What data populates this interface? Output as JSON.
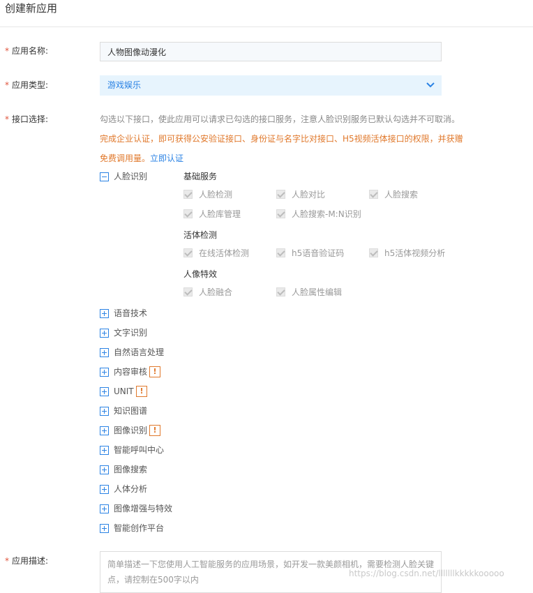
{
  "page_title": "创建新应用",
  "form": {
    "required_mark": "*",
    "app_name": {
      "label": "应用名称:",
      "value": "人物图像动漫化"
    },
    "app_type": {
      "label": "应用类型:",
      "value": "游戏娱乐",
      "icon": "chevron-down-icon"
    },
    "api_select": {
      "label": "接口选择:",
      "hint": "勾选以下接口，使此应用可以请求已勾选的接口服务，注意人脸识别服务已默认勾选并不可取消。",
      "notice": "完成企业认证，即可获得公安验证接口、身份证与名字比对接口、H5视频活体接口的权限，并获赠免费调用量。",
      "notice_link": "立即认证"
    },
    "app_desc": {
      "label": "应用描述:",
      "placeholder": "简单描述一下您使用人工智能服务的应用场景，如开发一款美颜相机，需要检测人脸关键点，请控制在500字以内"
    }
  },
  "face_recognition": {
    "label": "人脸识别",
    "groups": [
      {
        "title": "基础服务",
        "items": [
          "人脸检测",
          "人脸对比",
          "人脸搜索",
          "人脸库管理",
          "人脸搜索-M:N识别"
        ]
      },
      {
        "title": "活体检测",
        "items": [
          "在线活体检测",
          "h5语音验证码",
          "h5活体视频分析"
        ]
      },
      {
        "title": "人像特效",
        "items": [
          "人脸融合",
          "人脸属性编辑"
        ]
      }
    ]
  },
  "categories": [
    {
      "label": "语音技术"
    },
    {
      "label": "文字识别"
    },
    {
      "label": "自然语言处理"
    },
    {
      "label": "内容审核",
      "warning": "!"
    },
    {
      "label": "UNIT",
      "warning": "!"
    },
    {
      "label": "知识图谱"
    },
    {
      "label": "图像识别",
      "warning": "!"
    },
    {
      "label": "智能呼叫中心"
    },
    {
      "label": "图像搜索"
    },
    {
      "label": "人体分析"
    },
    {
      "label": "图像增强与特效"
    },
    {
      "label": "智能创作平台"
    }
  ],
  "watermark": "https://blog.csdn.net/lllllllkkkkkooooo"
}
